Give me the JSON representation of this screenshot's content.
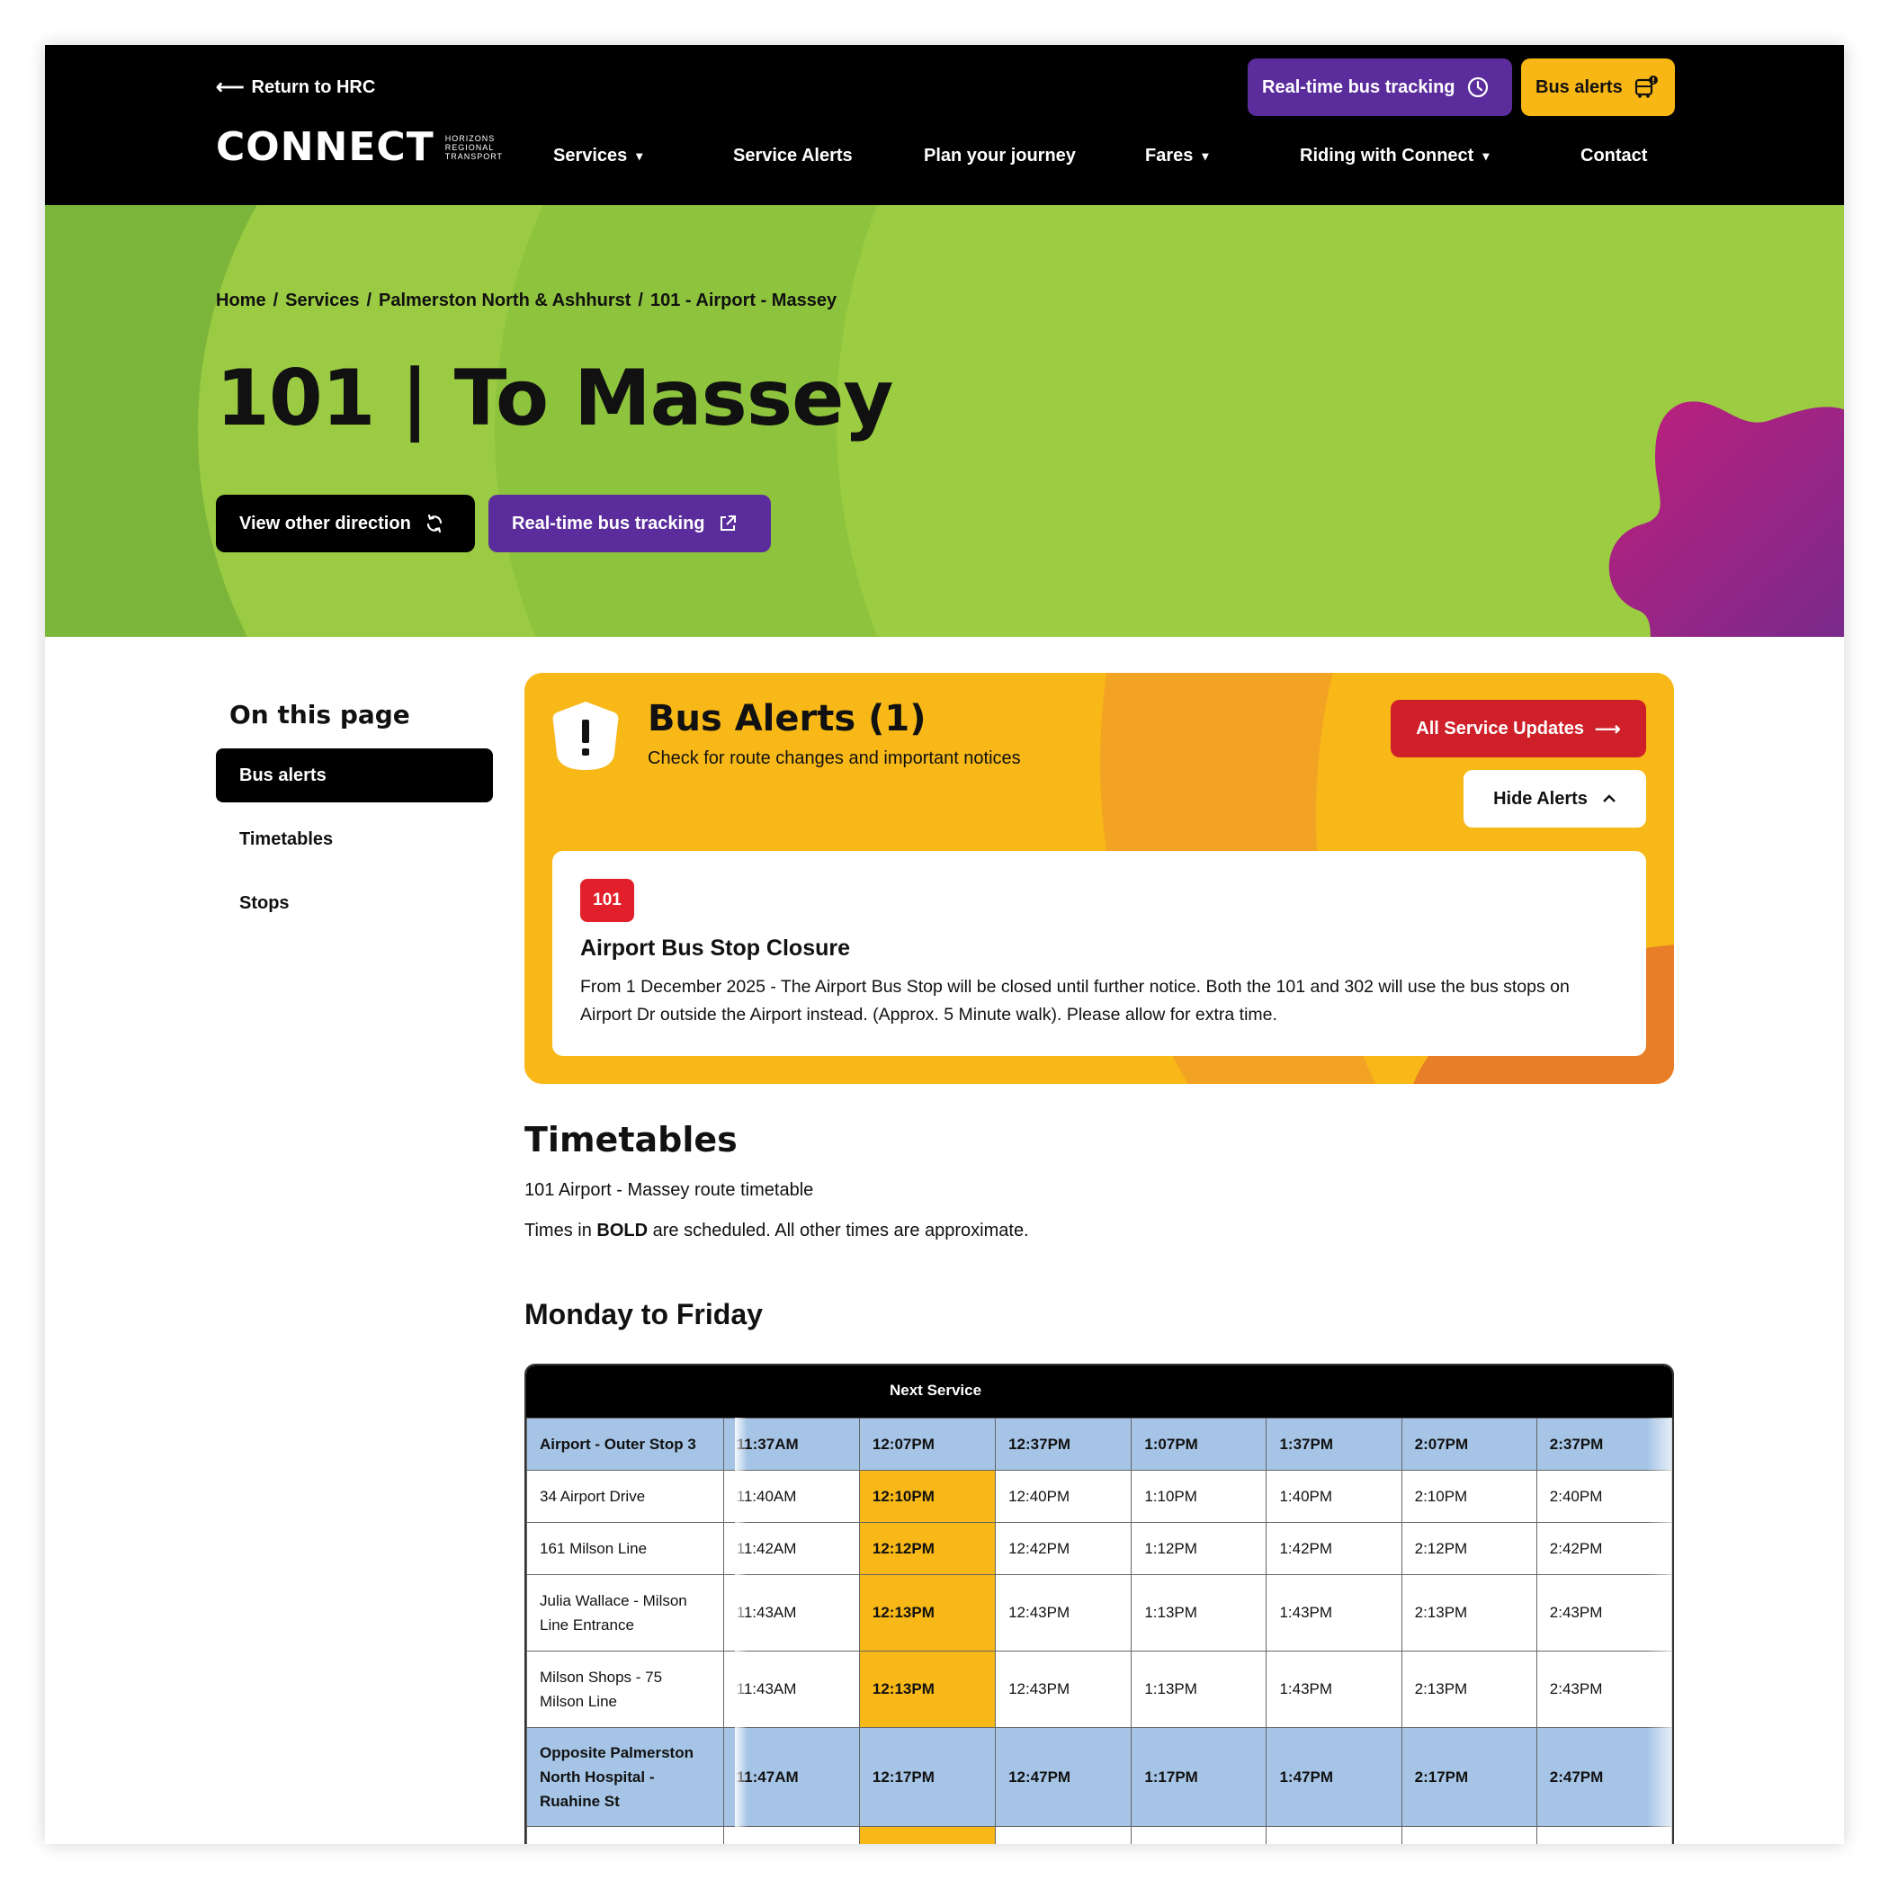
{
  "header": {
    "return_link": "Return to HRC",
    "logo_text": "CONNECT",
    "logo_sub": [
      "HORIZONS",
      "REGIONAL",
      "TRANSPORT"
    ],
    "realtime_label": "Real-time bus tracking",
    "bus_alerts_label": "Bus alerts",
    "nav": [
      {
        "label": "Services",
        "has_dropdown": true
      },
      {
        "label": "Service Alerts",
        "has_dropdown": false
      },
      {
        "label": "Plan your journey",
        "has_dropdown": false
      },
      {
        "label": "Fares",
        "has_dropdown": true
      },
      {
        "label": "Riding with Connect",
        "has_dropdown": true
      },
      {
        "label": "Contact",
        "has_dropdown": false
      }
    ]
  },
  "hero": {
    "breadcrumb": [
      "Home",
      "Services",
      "Palmerston North & Ashhurst",
      "101 - Airport - Massey"
    ],
    "title": "101 | To Massey",
    "view_other_direction": "View other direction",
    "realtime_tracking": "Real-time bus tracking"
  },
  "sidebar": {
    "title": "On this page",
    "items": [
      {
        "label": "Bus alerts",
        "active": true
      },
      {
        "label": "Timetables",
        "active": false
      },
      {
        "label": "Stops",
        "active": false
      }
    ]
  },
  "alerts": {
    "title": "Bus Alerts (1)",
    "subtitle": "Check for route changes and important notices",
    "all_updates": "All Service Updates",
    "hide_alerts": "Hide Alerts",
    "items": [
      {
        "route": "101",
        "title": "Airport Bus Stop Closure",
        "body": "From 1 December 2025 - The Airport Bus Stop will be closed until further notice. Both the 101 and 302 will use the bus stops on Airport Dr outside the Airport instead. (Approx. 5 Minute walk). Please allow for extra time."
      }
    ]
  },
  "timetables": {
    "title": "Timetables",
    "description": "101 Airport - Massey route timetable",
    "note_prefix": "Times in ",
    "note_bold": "BOLD",
    "note_suffix": " are scheduled. All other times are approximate.",
    "day": "Monday to Friday",
    "next_service_label": "Next Service",
    "rows": [
      {
        "stop": "Airport - Outer Stop 3",
        "timing": true,
        "times": [
          "11:37AM",
          "12:07PM",
          "12:37PM",
          "1:07PM",
          "1:37PM",
          "2:07PM",
          "2:37PM"
        ]
      },
      {
        "stop": "34 Airport Drive",
        "timing": false,
        "times": [
          "11:40AM",
          "12:10PM",
          "12:40PM",
          "1:10PM",
          "1:40PM",
          "2:10PM",
          "2:40PM"
        ]
      },
      {
        "stop": "161 Milson Line",
        "timing": false,
        "times": [
          "11:42AM",
          "12:12PM",
          "12:42PM",
          "1:12PM",
          "1:42PM",
          "2:12PM",
          "2:42PM"
        ]
      },
      {
        "stop": "Julia Wallace - Milson Line Entrance",
        "timing": false,
        "times": [
          "11:43AM",
          "12:13PM",
          "12:43PM",
          "1:13PM",
          "1:43PM",
          "2:13PM",
          "2:43PM"
        ]
      },
      {
        "stop": "Milson Shops - 75 Milson Line",
        "timing": false,
        "times": [
          "11:43AM",
          "12:13PM",
          "12:43PM",
          "1:13PM",
          "1:43PM",
          "2:13PM",
          "2:43PM"
        ]
      },
      {
        "stop": "Opposite Palmerston North Hospital - Ruahine St",
        "timing": true,
        "times": [
          "11:47AM",
          "12:17PM",
          "12:47PM",
          "1:17PM",
          "1:47PM",
          "2:17PM",
          "2:47PM"
        ]
      }
    ]
  },
  "colors": {
    "header_bg": "#000000",
    "hero_green": "#8cc63e",
    "purple": "#5b2d9c",
    "yellow": "#f8b817",
    "red": "#cf2029",
    "timing_blue": "#a5c4e6",
    "blob_magenta": "#b2237f"
  }
}
